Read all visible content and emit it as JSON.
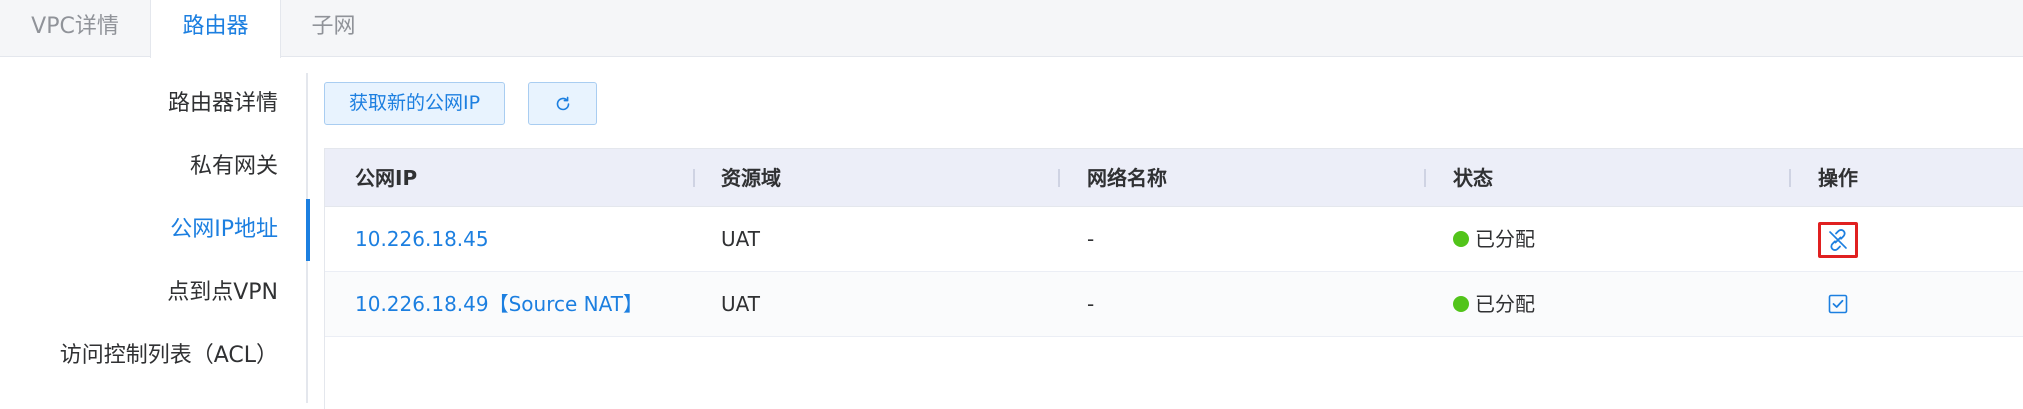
{
  "tabs": [
    {
      "label": "VPC详情",
      "active": false
    },
    {
      "label": "路由器",
      "active": true
    },
    {
      "label": "子网",
      "active": false
    }
  ],
  "sidebar": {
    "items": [
      {
        "label": "路由器详情",
        "active": false
      },
      {
        "label": "私有网关",
        "active": false
      },
      {
        "label": "公网IP地址",
        "active": true
      },
      {
        "label": "点到点VPN",
        "active": false
      },
      {
        "label": "访问控制列表（ACL）",
        "active": false
      }
    ]
  },
  "toolbar": {
    "acquire_label": "获取新的公网IP",
    "refresh_icon": "refresh-icon"
  },
  "table": {
    "columns": [
      "公网IP",
      "资源域",
      "网络名称",
      "状态",
      "操作"
    ],
    "rows": [
      {
        "ip": "10.226.18.45",
        "domain": "UAT",
        "network": "-",
        "status": "已分配",
        "action_icon": "disassociate-link-icon"
      },
      {
        "ip": "10.226.18.49【Source NAT】",
        "domain": "UAT",
        "network": "-",
        "status": "已分配",
        "action_icon": "checkbox-checked-icon"
      }
    ]
  },
  "colors": {
    "accent": "#1c7fe0",
    "status_ok": "#52c41a",
    "highlight": "#e02020"
  }
}
